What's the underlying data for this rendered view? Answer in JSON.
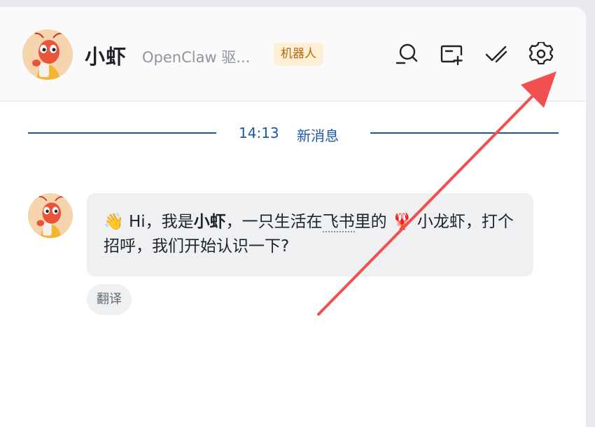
{
  "header": {
    "name": "小虾",
    "description": "OpenClaw 驱...",
    "badge": "机器人",
    "icons": [
      "search-icon",
      "add-window-icon",
      "mark-done-icon",
      "settings-icon"
    ]
  },
  "divider": {
    "time": "14:13",
    "label": "新消息"
  },
  "message": {
    "wave": "👋",
    "part1": " Hi，我是",
    "bold": "小虾",
    "part2": "，一只生活在",
    "dotted": "飞书",
    "part3": "里的 ",
    "lobster": "🦞",
    "part4": " 小龙虾，打个招呼，我们开始认识一下?"
  },
  "translate_label": "翻译",
  "colors": {
    "accent": "#1f57a8",
    "badge_bg": "#fdf0d6",
    "badge_text": "#b4690e",
    "arrow": "#f0504f"
  }
}
